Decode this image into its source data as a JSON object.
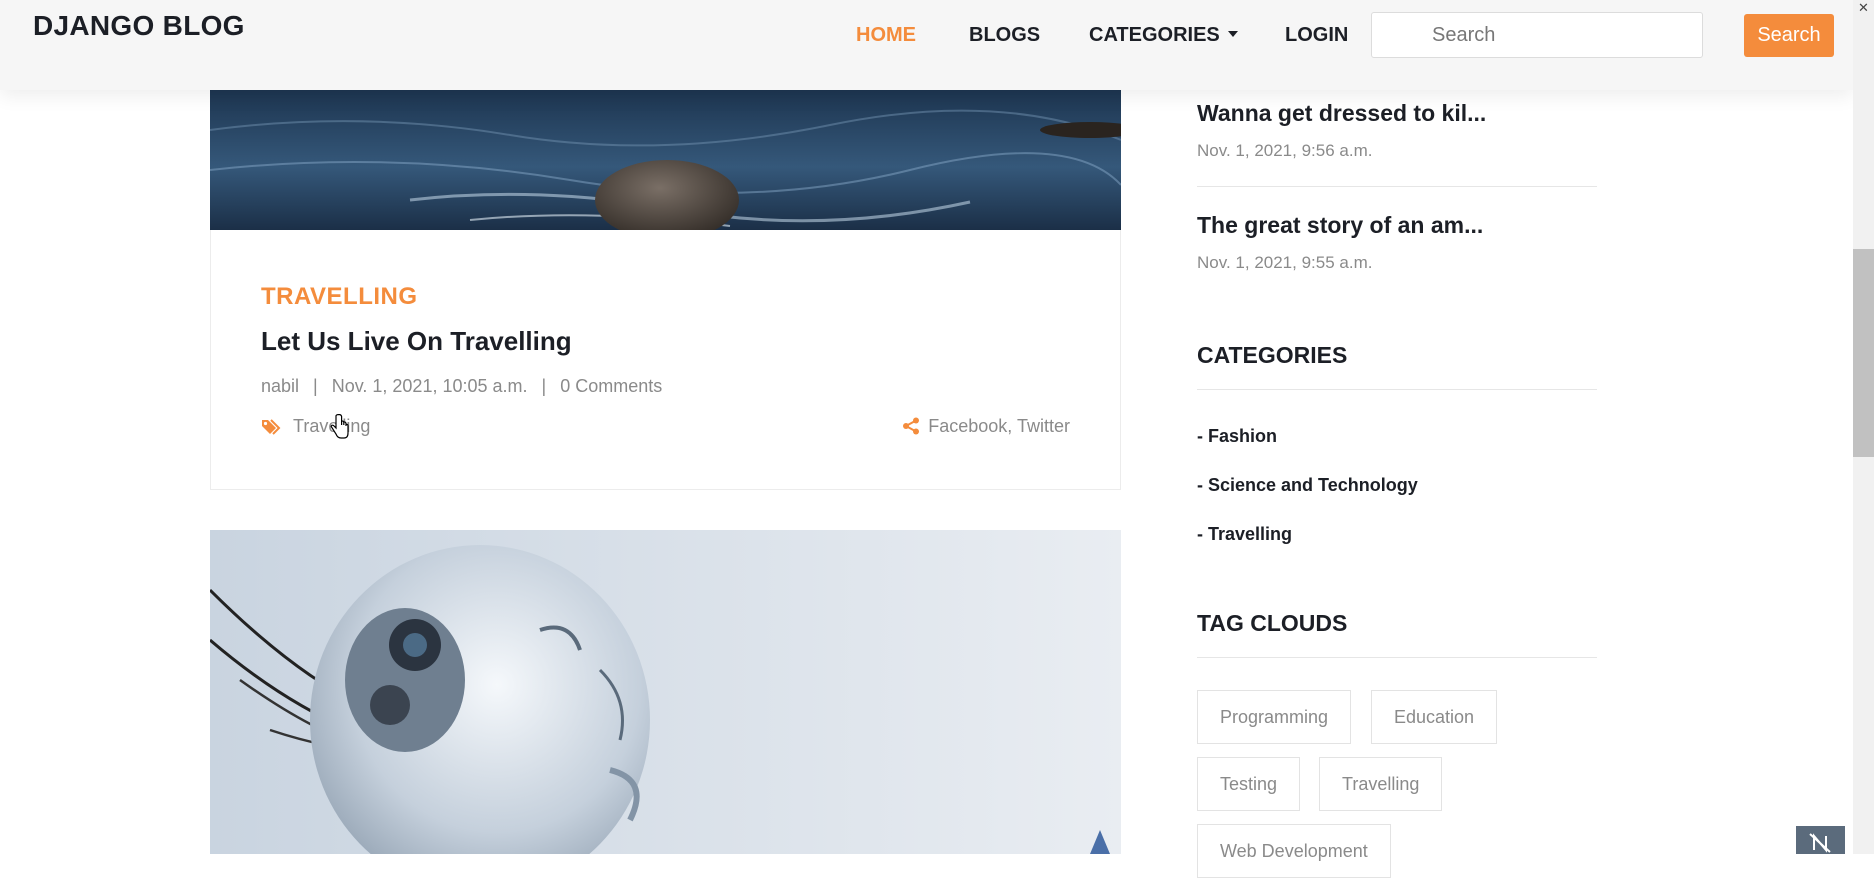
{
  "header": {
    "brand": "DJANGO BLOG",
    "nav": [
      {
        "label": "HOME",
        "active": true
      },
      {
        "label": "BLOGS",
        "active": false
      },
      {
        "label": "CATEGORIES",
        "active": false
      },
      {
        "label": "LOGIN",
        "active": false
      }
    ],
    "search_placeholder": "Search",
    "search_button": "Search"
  },
  "posts": [
    {
      "category": "TRAVELLING",
      "title": "Let Us Live On Travelling",
      "author": "nabil",
      "sep": "|",
      "date": "Nov. 1, 2021, 10:05 a.m.",
      "comments": "0 Comments",
      "tag": "Travelling",
      "share_facebook": "Facebook",
      "share_comma": ",",
      "share_twitter": "Twitter"
    }
  ],
  "sidebar": {
    "recent_posts": [
      {
        "title": "Wanna get dressed to kil...",
        "date": "Nov. 1, 2021, 9:56 a.m."
      },
      {
        "title": "The great story of an am...",
        "date": "Nov. 1, 2021, 9:55 a.m."
      }
    ],
    "categories_heading": "CATEGORIES",
    "categories": [
      "- Fashion",
      "- Science and Technology",
      "- Travelling"
    ],
    "tag_clouds_heading": "TAG CLOUDS",
    "tags": [
      "Programming",
      "Education",
      "Testing",
      "Travelling",
      "Web Development"
    ]
  },
  "colors": {
    "accent": "#f48c3c",
    "text": "#1c1f26",
    "muted": "#8a8a8a"
  },
  "icons": {
    "tag": "tags-icon",
    "share": "share-icon",
    "caret": "chevron-down-icon"
  }
}
